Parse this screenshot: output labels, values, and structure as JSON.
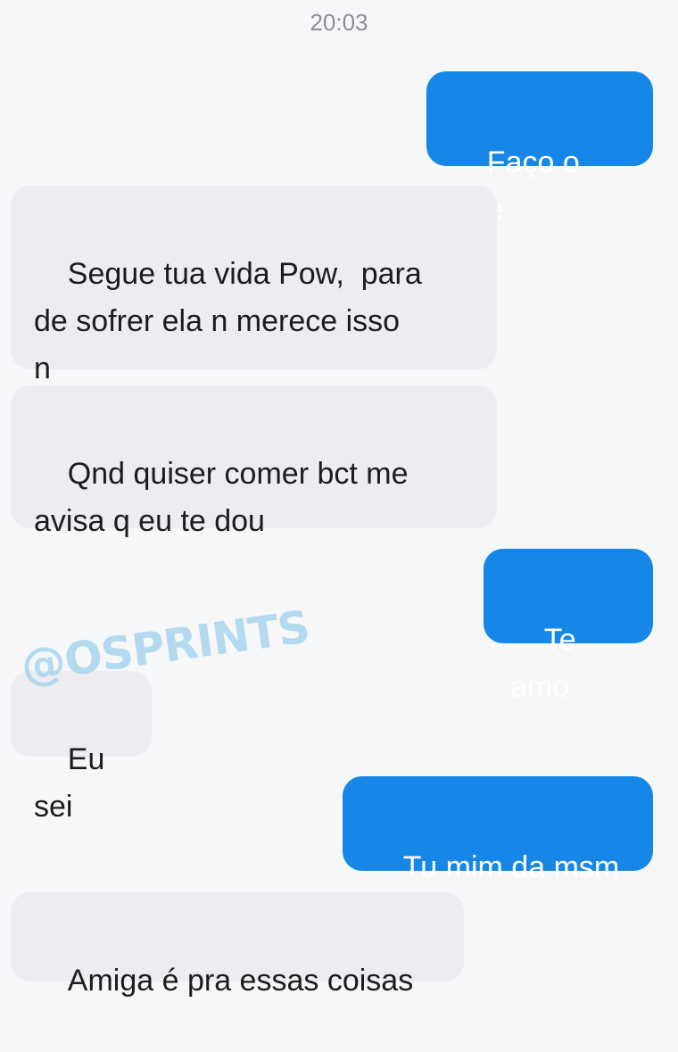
{
  "status": {
    "time": "20:03"
  },
  "messages": [
    {
      "direction": "sent",
      "text": "Faço o que"
    },
    {
      "direction": "received",
      "text": "Segue tua vida Pow,  para\nde sofrer ela n merece isso\nn"
    },
    {
      "direction": "received",
      "text": "Qnd quiser comer bct me\navisa q eu te dou"
    },
    {
      "direction": "sent",
      "text": "Te amo"
    },
    {
      "direction": "received",
      "text": "Eu sei"
    },
    {
      "direction": "sent",
      "text": "Tu mim da msm"
    },
    {
      "direction": "received",
      "text": "Amiga é pra essas coisas"
    }
  ],
  "watermark": "@OSPRINTS",
  "colors": {
    "sent_bubble": "#1687e7",
    "received_bubble": "#ececf1",
    "background": "#f6f7f9"
  }
}
